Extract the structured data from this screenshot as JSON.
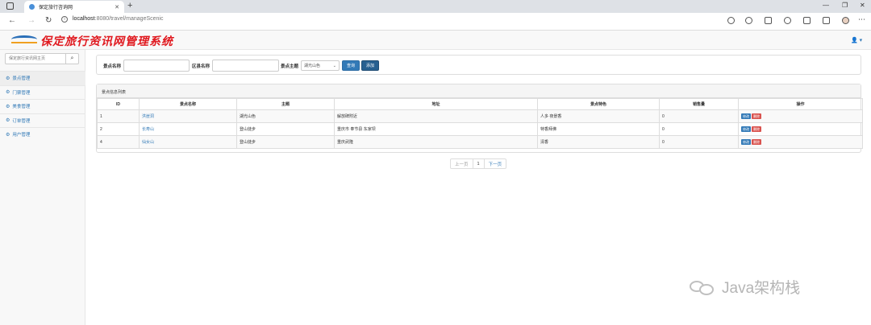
{
  "browser": {
    "tab_title": "保定旅行咨询网",
    "tab_close": "✕",
    "new_tab": "+",
    "url_host": "localhost",
    "url_rest": ":8080/travel/manageScenic",
    "back": "←",
    "forward": "→",
    "reload": "↻",
    "minimize": "—",
    "maximize": "❐",
    "close": "✕",
    "menu": "⋯"
  },
  "header": {
    "title": "保定旅行资讯网管理系统",
    "user_icon": "👤 ▾"
  },
  "sidebar": {
    "search_placeholder": "保定旅行资讯网主页",
    "search_icon": "⌕",
    "items": [
      {
        "icon": "⚙",
        "label": "景点管理"
      },
      {
        "icon": "⚙",
        "label": "门票管理"
      },
      {
        "icon": "⚙",
        "label": "美食管理"
      },
      {
        "icon": "⚙",
        "label": "订单管理"
      },
      {
        "icon": "⚙",
        "label": "用户管理"
      }
    ]
  },
  "filter": {
    "name_label": "景点名称",
    "area_label": "区县名称",
    "theme_label": "景点主题",
    "theme_selected": "湖光山色",
    "query_label": "查询",
    "add_label": "添加"
  },
  "list": {
    "heading": "景点信息列表",
    "columns": [
      "ID",
      "景点名称",
      "主题",
      "地址",
      "景点特色",
      "销售量",
      "操作"
    ],
    "rows": [
      {
        "id": "1",
        "name": "洪崖洞",
        "theme": "湖光山色",
        "address": "解放碑附近",
        "feature": "人多 夜景香",
        "sales": "0"
      },
      {
        "id": "2",
        "name": "长寿山",
        "theme": "登山徒步",
        "address": "重庆市 奉节县 东家坝",
        "feature": "特香拜佛",
        "sales": "0"
      },
      {
        "id": "4",
        "name": "仙女山",
        "theme": "登山徒步",
        "address": "重庆武隆",
        "feature": "清香",
        "sales": "0"
      }
    ],
    "edit_label": "修改",
    "delete_label": "删除"
  },
  "pager": {
    "prev": "上一页",
    "current": "1",
    "next": "下一页"
  },
  "watermark": {
    "text": "Java架构栈"
  }
}
